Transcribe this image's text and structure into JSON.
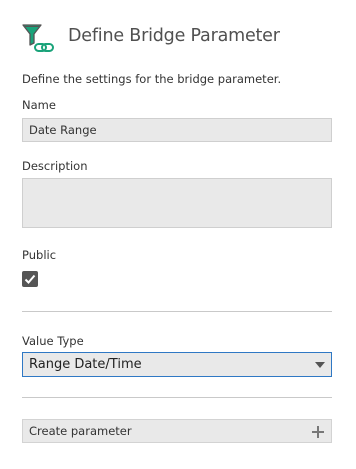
{
  "header": {
    "title": "Define Bridge Parameter",
    "icon": "filter-link-icon"
  },
  "intro": "Define the settings for the bridge parameter.",
  "name": {
    "label": "Name",
    "value": "Date Range"
  },
  "description": {
    "label": "Description",
    "value": ""
  },
  "public": {
    "label": "Public",
    "checked": true
  },
  "value_type": {
    "label": "Value Type",
    "selected": "Range Date/Time"
  },
  "create_button": {
    "label": "Create parameter",
    "icon": "plus-icon"
  },
  "colors": {
    "accent_green": "#1aa37a",
    "focus_border": "#2f78c4",
    "field_bg": "#e9e9e9"
  }
}
